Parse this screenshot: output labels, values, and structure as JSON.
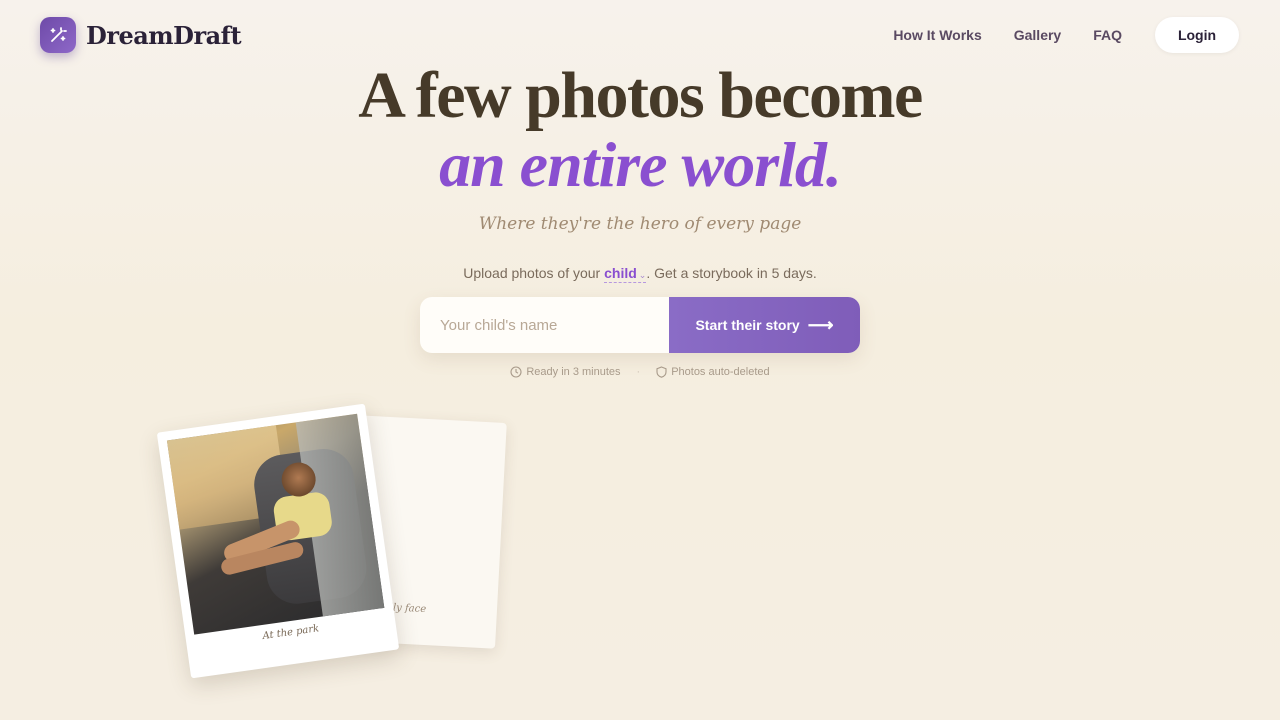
{
  "brand": {
    "name": "DreamDraft",
    "icon": "magic-wand-icon"
  },
  "nav": {
    "links": [
      "How It Works",
      "Gallery",
      "FAQ"
    ],
    "login_label": "Login"
  },
  "hero": {
    "line1": "A few photos become",
    "line2": "an entire world.",
    "subtitle": "Where they're the hero of every page"
  },
  "upload": {
    "prefix": "Upload photos of your",
    "selected": "child",
    "suffix": ". Get a storybook in 5 days."
  },
  "form": {
    "name_placeholder": "Your child's name",
    "name_value": "",
    "cta_label": "Start their story",
    "cta_icon": "arrow-right-icon"
  },
  "meta": {
    "ready": "Ready in 3 minutes",
    "ready_icon": "clock-icon",
    "privacy": "Photos auto-deleted",
    "privacy_icon": "shield-icon",
    "separator": "·"
  },
  "photos": [
    {
      "caption": "At the park"
    },
    {
      "caption": "Silly face"
    }
  ],
  "colors": {
    "accent": "#8a4fd0",
    "cta": "#8a6cc6",
    "heading": "#463a29",
    "background": "#f6f0e4"
  }
}
